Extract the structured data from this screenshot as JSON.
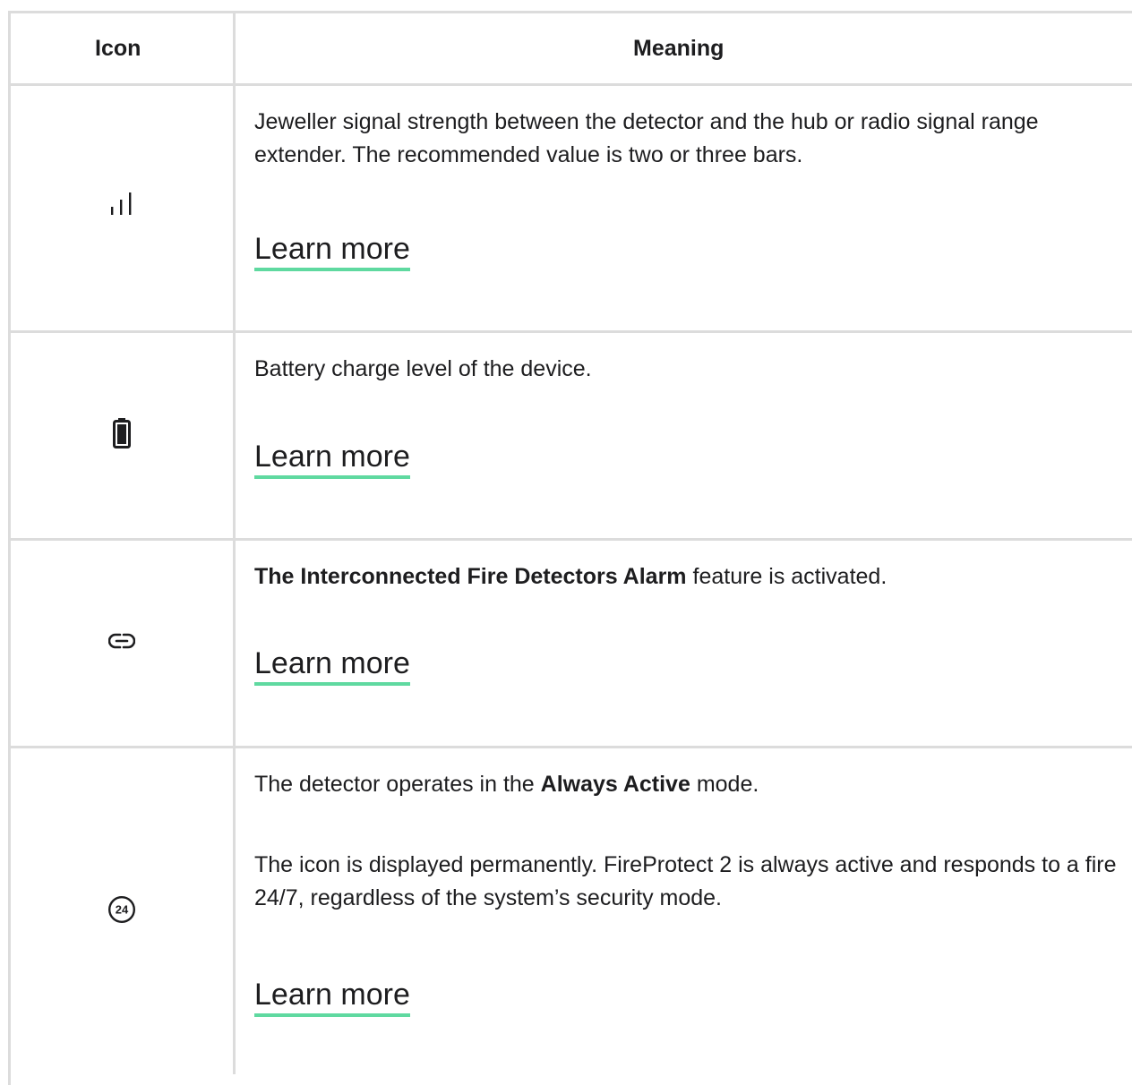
{
  "table": {
    "headers": {
      "icon": "Icon",
      "meaning": "Meaning"
    },
    "rows": [
      {
        "icon": "signal-strength-icon",
        "paragraphs": [
          {
            "pre": "Jeweller signal strength between the detector and the hub or radio signal range extender. The recommended value is two or three bars.",
            "bold": "",
            "post": ""
          }
        ],
        "link": "Learn more"
      },
      {
        "icon": "battery-icon",
        "paragraphs": [
          {
            "pre": "Battery charge level of the device.",
            "bold": "",
            "post": ""
          }
        ],
        "link": "Learn more"
      },
      {
        "icon": "link-icon",
        "paragraphs": [
          {
            "pre": "",
            "bold": "The Interconnected Fire Detectors Alarm",
            "post": " feature is activated."
          }
        ],
        "link": "Learn more"
      },
      {
        "icon": "always-active-24-icon",
        "icon_text": "24",
        "paragraphs": [
          {
            "pre": "The detector operates in the ",
            "bold": "Always Active",
            "post": " mode."
          },
          {
            "pre": "The icon is displayed permanently. FireProtect 2 is always active and responds to a fire 24/7, regardless of the system’s security mode.",
            "bold": "",
            "post": ""
          }
        ],
        "link": "Learn more"
      }
    ]
  },
  "colors": {
    "border": "#dcdcdc",
    "link_underline": "#5fd9a0",
    "text": "#1d1d1f"
  }
}
